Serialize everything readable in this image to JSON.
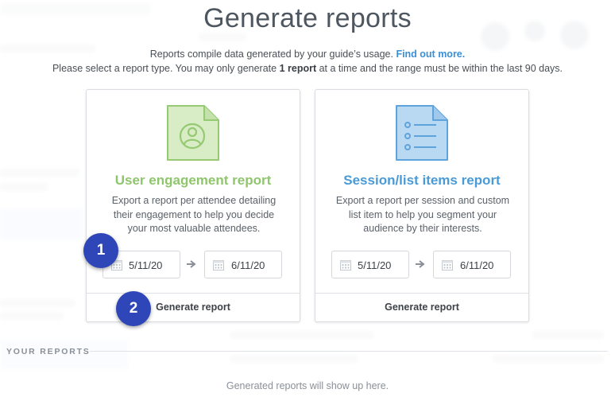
{
  "modal": {
    "title": "Generate reports",
    "description_line1": "Reports compile data generated by your guide’s usage.",
    "find_out_more": "Find out more.",
    "description_line2_pre": "Please select a report type. You may only generate ",
    "description_line2_bold": "1 report",
    "description_line2_post": " at a time and the range must be within the last 90 days."
  },
  "cards": [
    {
      "title": "User engagement report",
      "description": "Export a report per attendee detailing their engagement to help you decide your most valuable attendees.",
      "from_date": "5/11/20",
      "to_date": "6/11/20",
      "button_label": "Generate report",
      "accent_color": "#8fc66d",
      "icon": "user-document-icon"
    },
    {
      "title": "Session/list items report",
      "description": "Export a report per session and custom list item to help you segment your audience by their interests.",
      "from_date": "5/11/20",
      "to_date": "6/11/20",
      "button_label": "Generate report",
      "accent_color": "#4a9ad6",
      "icon": "list-document-icon"
    }
  ],
  "badges": [
    "1",
    "2"
  ],
  "your_reports": {
    "heading": "YOUR REPORTS",
    "empty_message": "Generated reports will show up here."
  }
}
